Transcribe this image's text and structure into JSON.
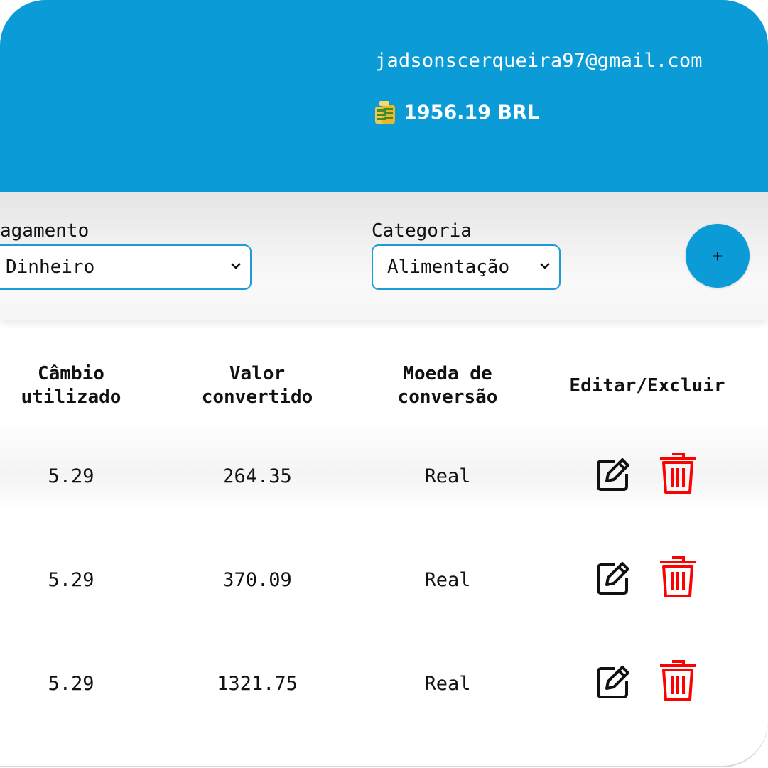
{
  "header": {
    "email": "jadsonscerqueira97@gmail.com",
    "balance": "1956.19 BRL",
    "balance_icon": "money-bag-icon",
    "background_color": "#0b9bd6"
  },
  "filters": {
    "payment": {
      "label": "agamento",
      "value": "Dinheiro"
    },
    "category": {
      "label": "Categoria",
      "value": "Alimentação"
    },
    "add_button_label": "+",
    "accent_color": "#1d9bd6"
  },
  "table": {
    "headers": {
      "cambio_line1": "Câmbio",
      "cambio_line2": "utilizado",
      "valor_line1": "Valor",
      "valor_line2": "convertido",
      "moeda_line1": "Moeda de",
      "moeda_line2": "conversão",
      "acoes": "Editar/Excluir"
    },
    "rows": [
      {
        "cambio": "5.29",
        "valor": "264.35",
        "moeda": "Real"
      },
      {
        "cambio": "5.29",
        "valor": "370.09",
        "moeda": "Real"
      },
      {
        "cambio": "5.29",
        "valor": "1321.75",
        "moeda": "Real"
      }
    ],
    "edit_icon": "edit-icon",
    "delete_icon": "trash-icon",
    "delete_color": "#ff0000"
  }
}
